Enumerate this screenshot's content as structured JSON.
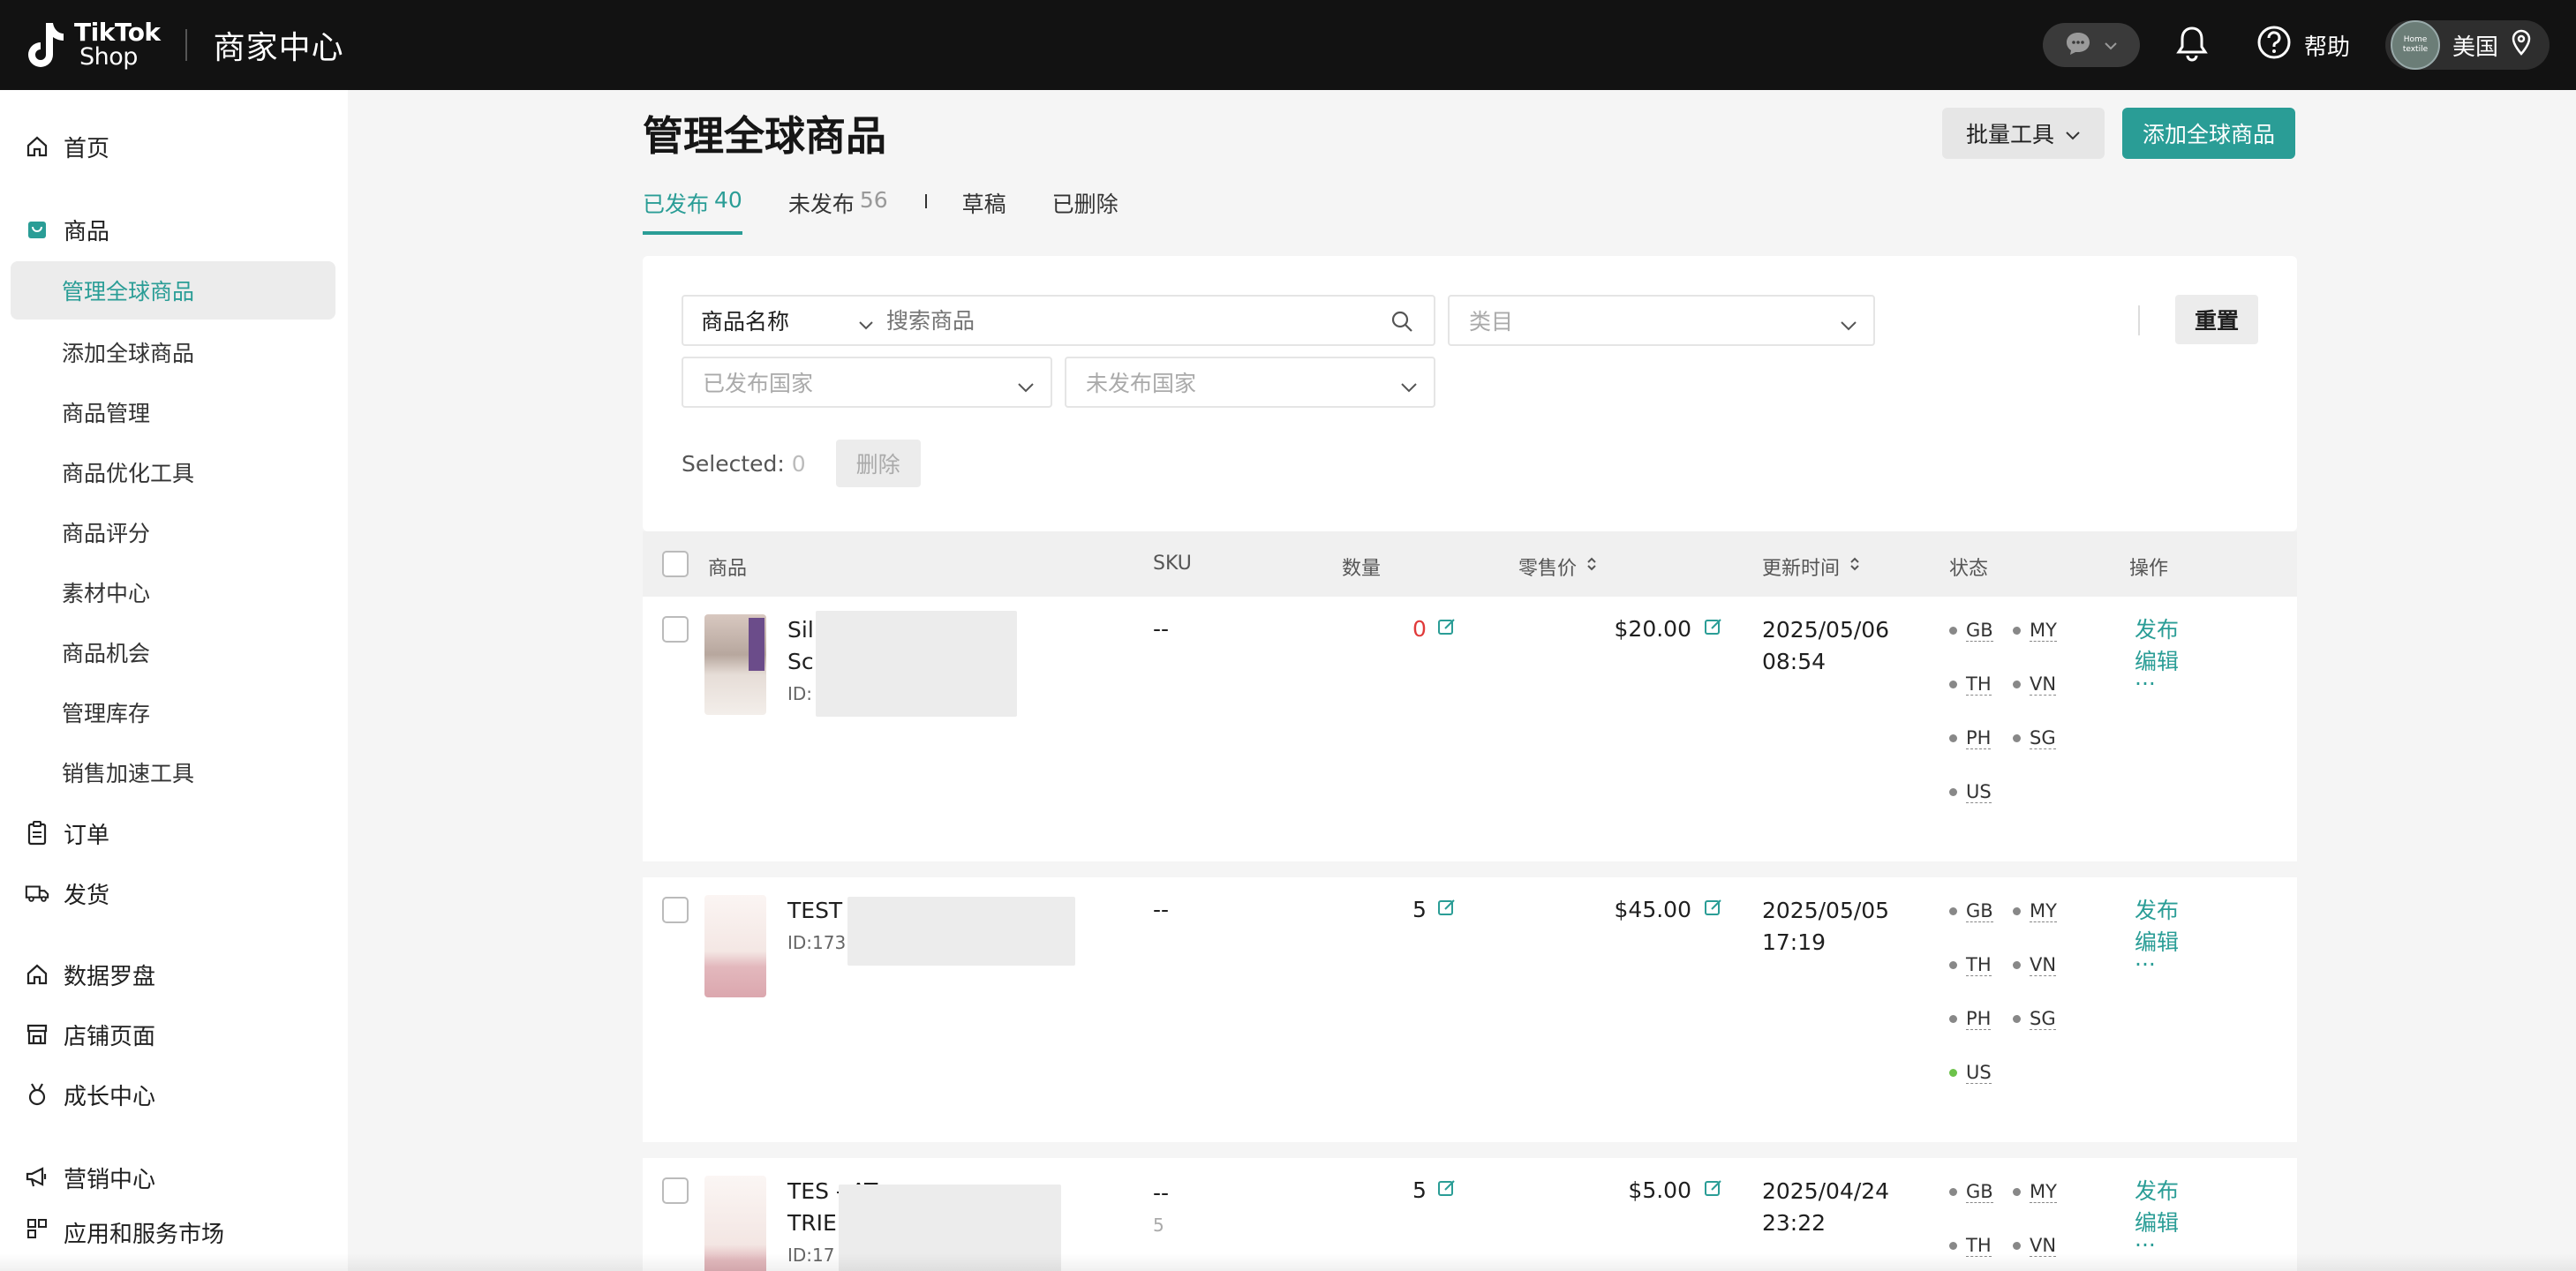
{
  "header": {
    "logo_line1": "TikTok",
    "logo_line2": "Shop",
    "title": "商家中心",
    "help": "帮助",
    "avatar_text": "Home textile",
    "region": "美国"
  },
  "sidebar": {
    "home": "首页",
    "products": "商品",
    "sub_items": [
      "管理全球商品",
      "添加全球商品",
      "商品管理",
      "商品优化工具",
      "商品评分",
      "素材中心",
      "商品机会",
      "管理库存",
      "销售加速工具"
    ],
    "orders": "订单",
    "shipping": "发货",
    "data_compass": "数据罗盘",
    "shop_page": "店铺页面",
    "growth_center": "成长中心",
    "marketing_center": "营销中心",
    "app_market": "应用和服务市场"
  },
  "page": {
    "title": "管理全球商品",
    "batch_tools": "批量工具",
    "add_product": "添加全球商品",
    "tabs": [
      {
        "label": "已发布",
        "count": "40"
      },
      {
        "label": "未发布",
        "count": "56"
      },
      {
        "label": "草稿",
        "count": ""
      },
      {
        "label": "已删除",
        "count": ""
      }
    ]
  },
  "filters": {
    "search_type": "商品名称",
    "search_placeholder": "搜索商品",
    "category_placeholder": "类目",
    "published_country_placeholder": "已发布国家",
    "unpublished_country_placeholder": "未发布国家",
    "reset": "重置",
    "selected_label": "Selected:",
    "selected_count": "0",
    "delete": "删除"
  },
  "table": {
    "columns": [
      "商品",
      "SKU",
      "数量",
      "零售价",
      "更新时间",
      "状态",
      "操作"
    ],
    "actions": {
      "publish": "发布",
      "edit": "编辑",
      "more": "···"
    },
    "rows": [
      {
        "name_line1": "Sil                    Surgical",
        "name_line2": "Sc                     Sheets ...",
        "id": "ID:                       0",
        "sku": "--",
        "sku_sub": "",
        "qty": "0",
        "price": "$20.00",
        "date_line1": "2025/05/06",
        "date_line2": "08:54",
        "statuses": [
          {
            "code": "GB",
            "active": false
          },
          {
            "code": "MY",
            "active": false
          },
          {
            "code": "TH",
            "active": false
          },
          {
            "code": "VN",
            "active": false
          },
          {
            "code": "PH",
            "active": false
          },
          {
            "code": "SG",
            "active": false
          },
          {
            "code": "US",
            "active": false
          }
        ]
      },
      {
        "name_line1": "TEST                        TS",
        "name_line2": "",
        "id": "ID:173",
        "sku": "--",
        "sku_sub": "",
        "qty": "5",
        "price": "$45.00",
        "date_line1": "2025/05/05",
        "date_line2": "17:19",
        "statuses": [
          {
            "code": "GB",
            "active": false
          },
          {
            "code": "MY",
            "active": false
          },
          {
            "code": "TH",
            "active": false
          },
          {
            "code": "VN",
            "active": false
          },
          {
            "code": "PH",
            "active": false
          },
          {
            "code": "SG",
            "active": false
          },
          {
            "code": "US",
            "active": true
          }
        ]
      },
      {
        "name_line1": "TES                         - AT",
        "name_line2": "TRIE",
        "id": "ID:17",
        "sku": "--",
        "sku_sub": "5",
        "qty": "5",
        "price": "$5.00",
        "date_line1": "2025/04/24",
        "date_line2": "23:22",
        "statuses": [
          {
            "code": "GB",
            "active": false
          },
          {
            "code": "MY",
            "active": false
          },
          {
            "code": "TH",
            "active": false
          },
          {
            "code": "VN",
            "active": false
          }
        ]
      }
    ]
  },
  "colors": {
    "accent": "#2a9d96",
    "topbar": "#121212",
    "danger": "#e03a3a",
    "active_status": "#6cc24a"
  }
}
